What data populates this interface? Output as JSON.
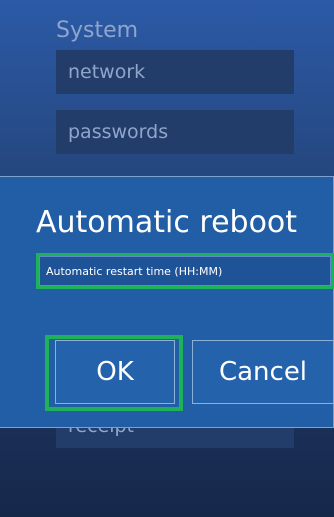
{
  "background": {
    "section_title": "System",
    "menu_items": [
      {
        "label": "network"
      },
      {
        "label": "passwords"
      },
      {
        "label": "receipt"
      }
    ]
  },
  "dialog": {
    "title": "Automatic reboot",
    "input": {
      "value": "",
      "placeholder": "Automatic restart time (HH:MM)"
    },
    "ok_label": "OK",
    "cancel_label": "Cancel"
  },
  "colors": {
    "dialog_bg": "#215ea6",
    "focus_highlight": "#1fb15a",
    "menu_item_bg": "#233d6a",
    "text_muted": "#8fa6cc"
  }
}
